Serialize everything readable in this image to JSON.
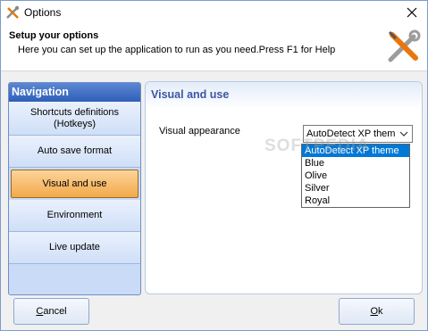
{
  "window": {
    "title": "Options"
  },
  "header": {
    "heading": "Setup your options",
    "description": "Here you can set up the application to run as you need.Press F1 for Help"
  },
  "navigation": {
    "title": "Navigation",
    "items": [
      {
        "line1": "Shortcuts definitions",
        "line2": "(Hotkeys)"
      },
      {
        "line1": "Auto save format"
      },
      {
        "line1": "Visual and use",
        "active": true
      },
      {
        "line1": "Environment"
      },
      {
        "line1": "Live update"
      }
    ]
  },
  "panel": {
    "title": "Visual and use",
    "visual_appearance_label": "Visual appearance",
    "combo_value": "AutoDetect XP them",
    "options": [
      "AutoDetect XP theme",
      "Blue",
      "Olive",
      "Silver",
      "Royal"
    ],
    "selected_index": 0
  },
  "buttons": {
    "cancel_first": "C",
    "cancel_rest": "ancel",
    "ok_first": "O",
    "ok_rest": "k"
  },
  "watermark": "SOFTPEDIA",
  "colors": {
    "accent": "#3c56a4",
    "nav_header": "#2f5fb8",
    "active_item": "#f3a94a",
    "selection": "#0078d7"
  }
}
